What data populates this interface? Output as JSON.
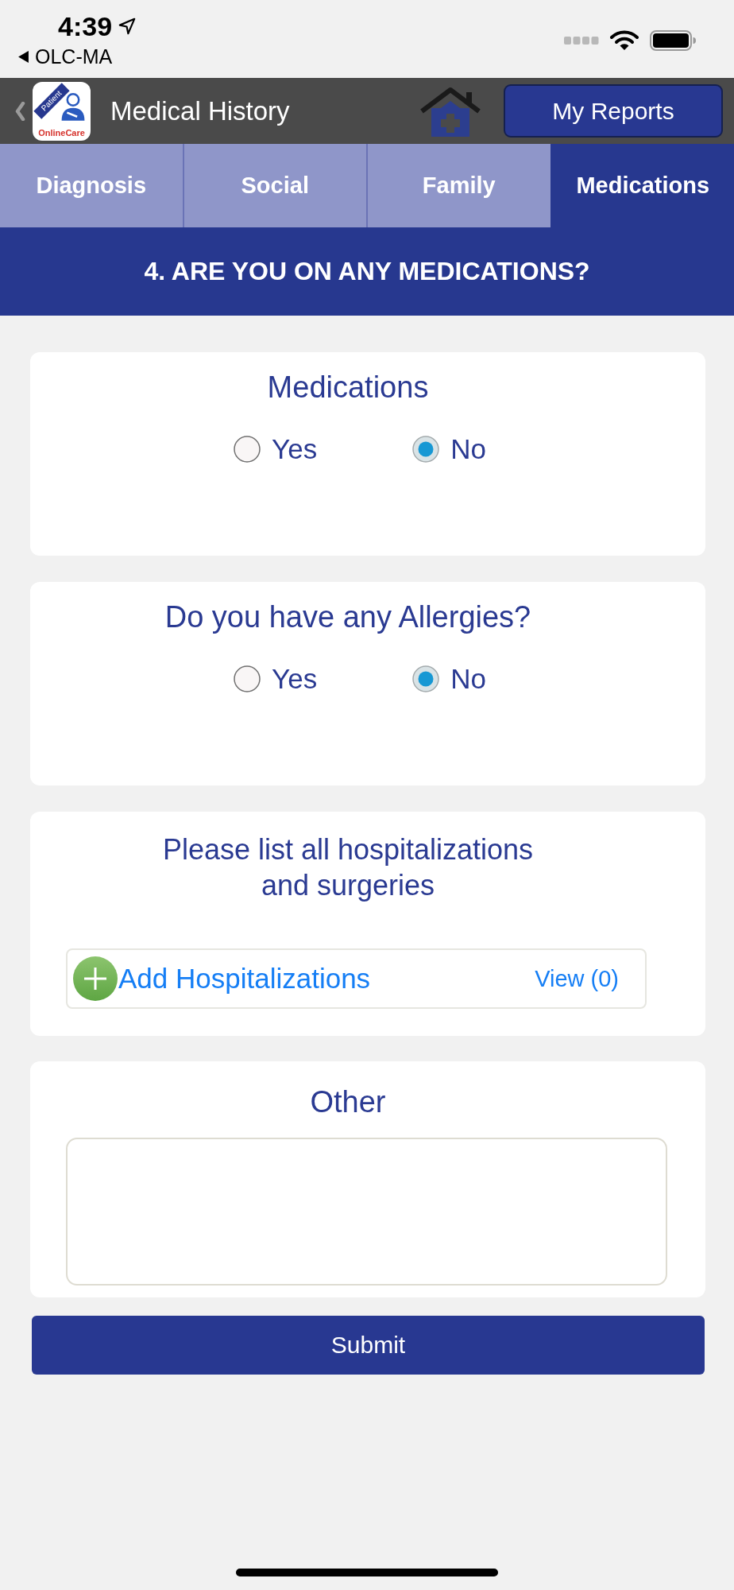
{
  "status_bar": {
    "time": "4:39",
    "back_app": "OLC-MA"
  },
  "header": {
    "logo": {
      "ribbon": "Patient",
      "brand": "OnlineCare"
    },
    "title": "Medical History",
    "reports_button": "My Reports"
  },
  "tabs": [
    {
      "label": "Diagnosis",
      "selected": false
    },
    {
      "label": "Social",
      "selected": false
    },
    {
      "label": "Family",
      "selected": false
    },
    {
      "label": "Medications",
      "selected": true
    }
  ],
  "section_title": "4. ARE YOU ON ANY MEDICATIONS?",
  "cards": [
    {
      "kind": "radio",
      "title": "Medications",
      "options": [
        {
          "label": "Yes",
          "selected": false
        },
        {
          "label": "No",
          "selected": true
        }
      ]
    },
    {
      "kind": "radio",
      "title": "Do you have any Allergies?",
      "options": [
        {
          "label": "Yes",
          "selected": false
        },
        {
          "label": "No",
          "selected": true
        }
      ]
    },
    {
      "kind": "list",
      "title": "Please list all hospitalizations\nand surgeries",
      "add_button": "Add Hospitalizations",
      "view_link": "View (0)"
    },
    {
      "kind": "textarea",
      "title": "Other"
    }
  ],
  "submit_button": "Submit"
}
